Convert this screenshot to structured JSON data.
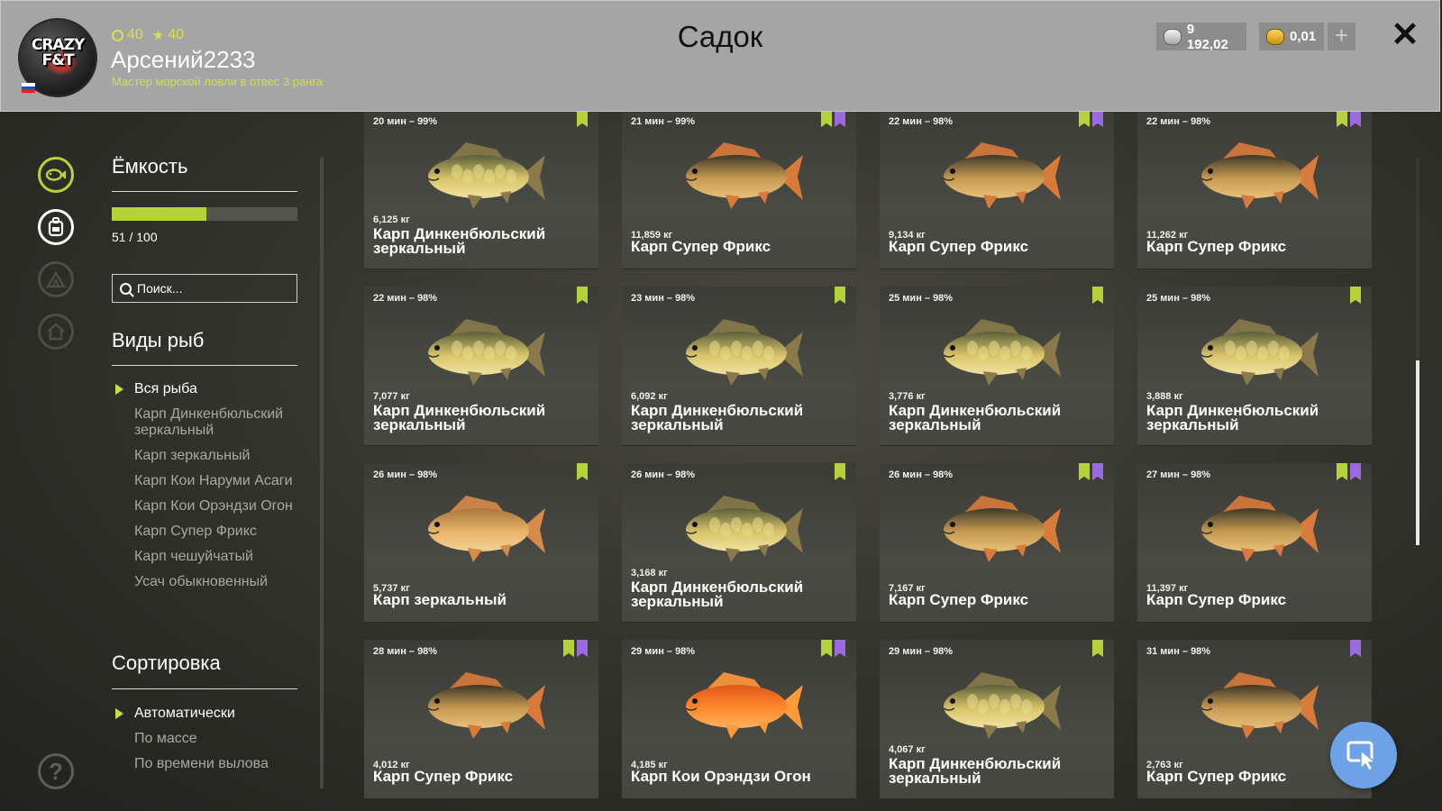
{
  "header": {
    "logo_text": "CRAZY F&T",
    "stat_ring": "40",
    "stat_star": "40",
    "username": "Арсений2233",
    "rank": "Мастер морской ловли в отвес 3 ранга",
    "title": "Садок",
    "silver": "9 192,02",
    "gold": "0,01",
    "plus_label": "+",
    "close_label": "✕"
  },
  "sidebar_icons": [
    "fish-keepnet-icon",
    "backpack-icon",
    "tent-icon",
    "home-icon",
    "help-icon"
  ],
  "capacity": {
    "heading": "Ёмкость",
    "used": 51,
    "max": 100,
    "label": "51 / 100"
  },
  "search": {
    "placeholder": "Поиск..."
  },
  "species": {
    "heading": "Виды рыб",
    "items": [
      {
        "label": "Вся рыба",
        "active": true
      },
      {
        "label": "Карп Динкенбюльский зеркальный",
        "active": false
      },
      {
        "label": "Карп зеркальный",
        "active": false
      },
      {
        "label": "Карп Кои Наруми Асаги",
        "active": false
      },
      {
        "label": "Карп Кои Орэндзи Огон",
        "active": false
      },
      {
        "label": "Карп Супер Фрикс",
        "active": false
      },
      {
        "label": "Карп чешуйчатый",
        "active": false
      },
      {
        "label": "Усач обыкновенный",
        "active": false
      }
    ]
  },
  "sorting": {
    "heading": "Сортировка",
    "items": [
      {
        "label": "Автоматически",
        "active": true
      },
      {
        "label": "По массе",
        "active": false
      },
      {
        "label": "По времени вылова",
        "active": false
      }
    ]
  },
  "colors": {
    "accent": "#b5d23c",
    "badge_green": "#b6d23a",
    "badge_purple": "#9a6ae0",
    "cursor_button": "#6ea2e6"
  },
  "fish": [
    {
      "time": "20 мин – 99%",
      "weight": "6,125 кг",
      "name": "Карп Динкенбюльский зеркальный",
      "badges": [
        "green"
      ],
      "kind": "mirror"
    },
    {
      "time": "21 мин – 99%",
      "weight": "11,859 кг",
      "name": "Карп Супер Фрикс",
      "badges": [
        "green",
        "purple"
      ],
      "kind": "superfrix"
    },
    {
      "time": "22 мин – 98%",
      "weight": "9,134 кг",
      "name": "Карп Супер Фрикс",
      "badges": [
        "green",
        "purple"
      ],
      "kind": "superfrix"
    },
    {
      "time": "22 мин – 98%",
      "weight": "11,262 кг",
      "name": "Карп Супер Фрикс",
      "badges": [
        "green",
        "purple"
      ],
      "kind": "superfrix"
    },
    {
      "time": "22 мин – 98%",
      "weight": "7,077 кг",
      "name": "Карп Динкенбюльский зеркальный",
      "badges": [
        "green"
      ],
      "kind": "mirror"
    },
    {
      "time": "23 мин – 98%",
      "weight": "6,092 кг",
      "name": "Карп Динкенбюльский зеркальный",
      "badges": [
        "green"
      ],
      "kind": "mirror"
    },
    {
      "time": "25 мин – 98%",
      "weight": "3,776 кг",
      "name": "Карп Динкенбюльский зеркальный",
      "badges": [
        "green"
      ],
      "kind": "mirror"
    },
    {
      "time": "25 мин – 98%",
      "weight": "3,888 кг",
      "name": "Карп Динкенбюльский зеркальный",
      "badges": [
        "green"
      ],
      "kind": "mirror"
    },
    {
      "time": "26 мин – 98%",
      "weight": "5,737 кг",
      "name": "Карп зеркальный",
      "badges": [
        "green"
      ],
      "kind": "common"
    },
    {
      "time": "26 мин – 98%",
      "weight": "3,168 кг",
      "name": "Карп Динкенбюльский зеркальный",
      "badges": [
        "green"
      ],
      "kind": "mirror"
    },
    {
      "time": "26 мин – 98%",
      "weight": "7,167 кг",
      "name": "Карп Супер Фрикс",
      "badges": [
        "green",
        "purple"
      ],
      "kind": "superfrix"
    },
    {
      "time": "27 мин – 98%",
      "weight": "11,397 кг",
      "name": "Карп Супер Фрикс",
      "badges": [
        "green",
        "purple"
      ],
      "kind": "superfrix"
    },
    {
      "time": "28 мин – 98%",
      "weight": "4,012 кг",
      "name": "Карп Супер Фрикс",
      "badges": [
        "green",
        "purple"
      ],
      "kind": "superfrix"
    },
    {
      "time": "29 мин – 98%",
      "weight": "4,185 кг",
      "name": "Карп Кои Орэндзи Огон",
      "badges": [
        "green",
        "purple"
      ],
      "kind": "koi"
    },
    {
      "time": "29 мин – 98%",
      "weight": "4,067 кг",
      "name": "Карп Динкенбюльский зеркальный",
      "badges": [
        "green"
      ],
      "kind": "mirror"
    },
    {
      "time": "31 мин – 98%",
      "weight": "2,763 кг",
      "name": "Карп Супер Фрикс",
      "badges": [
        "purple"
      ],
      "kind": "superfrix"
    }
  ]
}
